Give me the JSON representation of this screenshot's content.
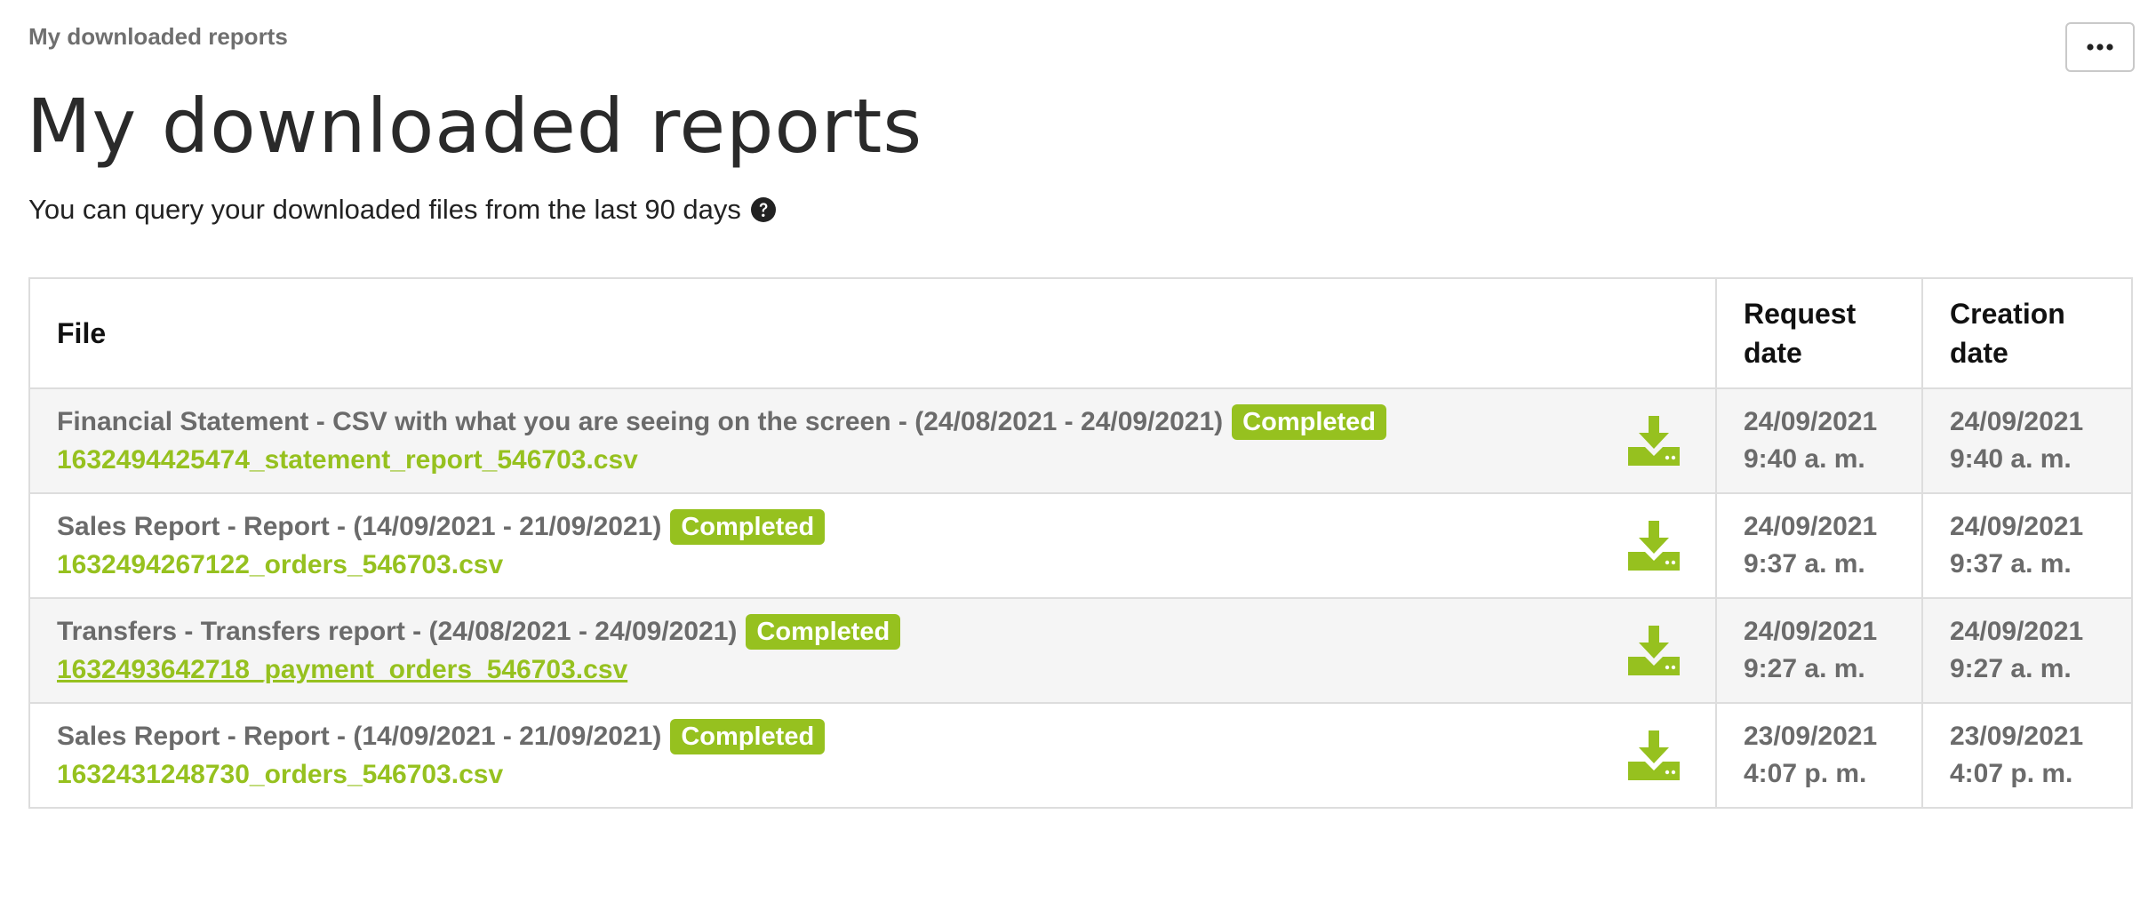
{
  "breadcrumb": "My downloaded reports",
  "more_button_label": "•••",
  "page_title": "My downloaded reports",
  "subtitle": "You can query your downloaded files from the last 90 days",
  "icons": {
    "help": "question-circle-icon",
    "download": "download-icon",
    "more": "ellipsis-icon"
  },
  "colors": {
    "accent": "#96c11f",
    "muted_text": "#6b6b6b",
    "row_alt": "#f5f5f5"
  },
  "table": {
    "headers": {
      "file": "File",
      "request_date": "Request date",
      "creation_date": "Creation date"
    },
    "rows": [
      {
        "title": "Financial Statement - CSV with what you are seeing on the screen - (24/08/2021 - 24/09/2021)",
        "status": "Completed",
        "filename": "1632494425474_statement_report_546703.csv",
        "request_date": "24/09/2021",
        "request_time": "9:40 a. m.",
        "creation_date": "24/09/2021",
        "creation_time": "9:40 a. m."
      },
      {
        "title": "Sales Report - Report - (14/09/2021 - 21/09/2021)",
        "status": "Completed",
        "filename": "1632494267122_orders_546703.csv",
        "request_date": "24/09/2021",
        "request_time": "9:37 a. m.",
        "creation_date": "24/09/2021",
        "creation_time": "9:37 a. m."
      },
      {
        "title": "Transfers - Transfers report - (24/08/2021 - 24/09/2021)",
        "status": "Completed",
        "filename": "1632493642718_payment_orders_546703.csv",
        "request_date": "24/09/2021",
        "request_time": "9:27 a. m.",
        "creation_date": "24/09/2021",
        "creation_time": "9:27 a. m."
      },
      {
        "title": "Sales Report - Report - (14/09/2021 - 21/09/2021)",
        "status": "Completed",
        "filename": "1632431248730_orders_546703.csv",
        "request_date": "23/09/2021",
        "request_time": "4:07 p. m.",
        "creation_date": "23/09/2021",
        "creation_time": "4:07 p. m."
      }
    ]
  }
}
